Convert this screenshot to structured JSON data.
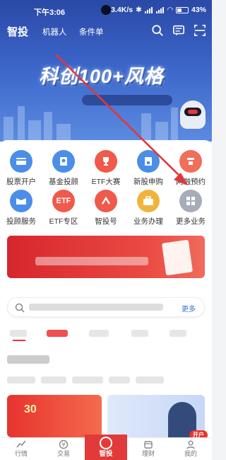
{
  "status_bar": {
    "time": "下午3:06",
    "speed": "3.4K/s",
    "battery": "43%"
  },
  "header": {
    "title": "智投",
    "nav": [
      "机器人",
      "条件单"
    ],
    "icons": [
      "search-icon",
      "message-icon",
      "scan-icon"
    ]
  },
  "banner": {
    "headline": "科创100+风格"
  },
  "quick_services": [
    {
      "label": "股票开户",
      "icon": "account-card-icon",
      "color": "#4a8ee8"
    },
    {
      "label": "基金投顾",
      "icon": "fund-advisor-icon",
      "color": "#4a8ee8"
    },
    {
      "label": "ETF大赛",
      "icon": "trophy-icon",
      "color": "#f05a4a"
    },
    {
      "label": "新股申购",
      "icon": "ipo-icon",
      "color": "#4a8ee8"
    },
    {
      "label": "两融预约",
      "icon": "margin-icon",
      "color": "#f06e5a"
    },
    {
      "label": "投顾服务",
      "icon": "advisor-icon",
      "color": "#4a8ee8"
    },
    {
      "label": "ETF专区",
      "icon": "etf-icon",
      "color": "#f05a4a",
      "glyph": "ETF"
    },
    {
      "label": "智投号",
      "icon": "zhitou-icon",
      "color": "#f05a4a"
    },
    {
      "label": "业务办理",
      "icon": "briefcase-icon",
      "color": "#f2b33d"
    },
    {
      "label": "更多业务",
      "icon": "more-grid-icon",
      "color": "#a7adb8"
    }
  ],
  "search": {
    "more": "更多"
  },
  "card": {
    "big_text": "30"
  },
  "badge": {
    "kaihu": "开户"
  },
  "bottom_nav": [
    {
      "label": "行情",
      "icon": "market-icon"
    },
    {
      "label": "交易",
      "icon": "trade-icon"
    },
    {
      "label": "智投",
      "icon": "smart-invest-icon",
      "active": true
    },
    {
      "label": "理财",
      "icon": "wealth-icon"
    },
    {
      "label": "我的",
      "icon": "profile-icon"
    }
  ],
  "colors": {
    "brand_blue": "#2b49a6",
    "accent_red": "#e23a3a",
    "annotation_arrow": "#e0373a"
  }
}
